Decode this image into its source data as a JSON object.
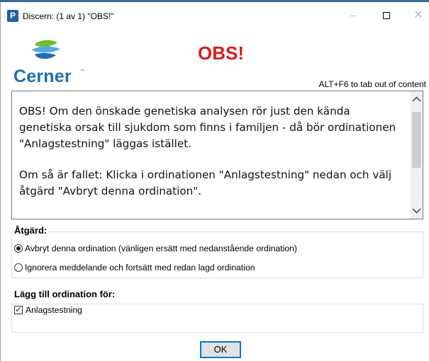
{
  "window": {
    "title": "Discern: (1 av 1) \"OBS!\"",
    "app_icon_letter": "P",
    "controls": {
      "minimize": "—",
      "maximize": "☐",
      "close": "✕"
    }
  },
  "header": {
    "logo_text": "Cerner",
    "logo_mark": "™",
    "headline": "OBS!",
    "keyboard_hint": "ALT+F6 to tab out of content",
    "colors": {
      "headline": "#d61c1c",
      "logo": "#1f6db5",
      "logo_swirl": "#6cbf2a"
    }
  },
  "message": {
    "paragraph_1": "OBS! Om den önskade genetiska analysen rör just den kända genetiska orsak till sjukdom som finns i familjen - då bör ordinationen \"Anlagstestning\" läggas istället.",
    "paragraph_2": "Om så är fallet: Klicka i ordinationen \"Anlagstestning\" nedan och välj åtgärd \"Avbryt denna ordination\".",
    "scroll_up": "^",
    "scroll_down": "v"
  },
  "action": {
    "label": "Åtgärd:",
    "options": [
      {
        "label": "Avbryt denna ordination (vänligen ersätt med nedanstående ordination)",
        "selected": true
      },
      {
        "label": "Ignorera meddelande och fortsätt med redan lagd ordination",
        "selected": false
      }
    ]
  },
  "add_order": {
    "label": "Lägg till ordination för:",
    "items": [
      {
        "label": "Anlagstestning",
        "checked": true,
        "check_mark": "✓"
      }
    ]
  },
  "buttons": {
    "ok": "OK"
  }
}
